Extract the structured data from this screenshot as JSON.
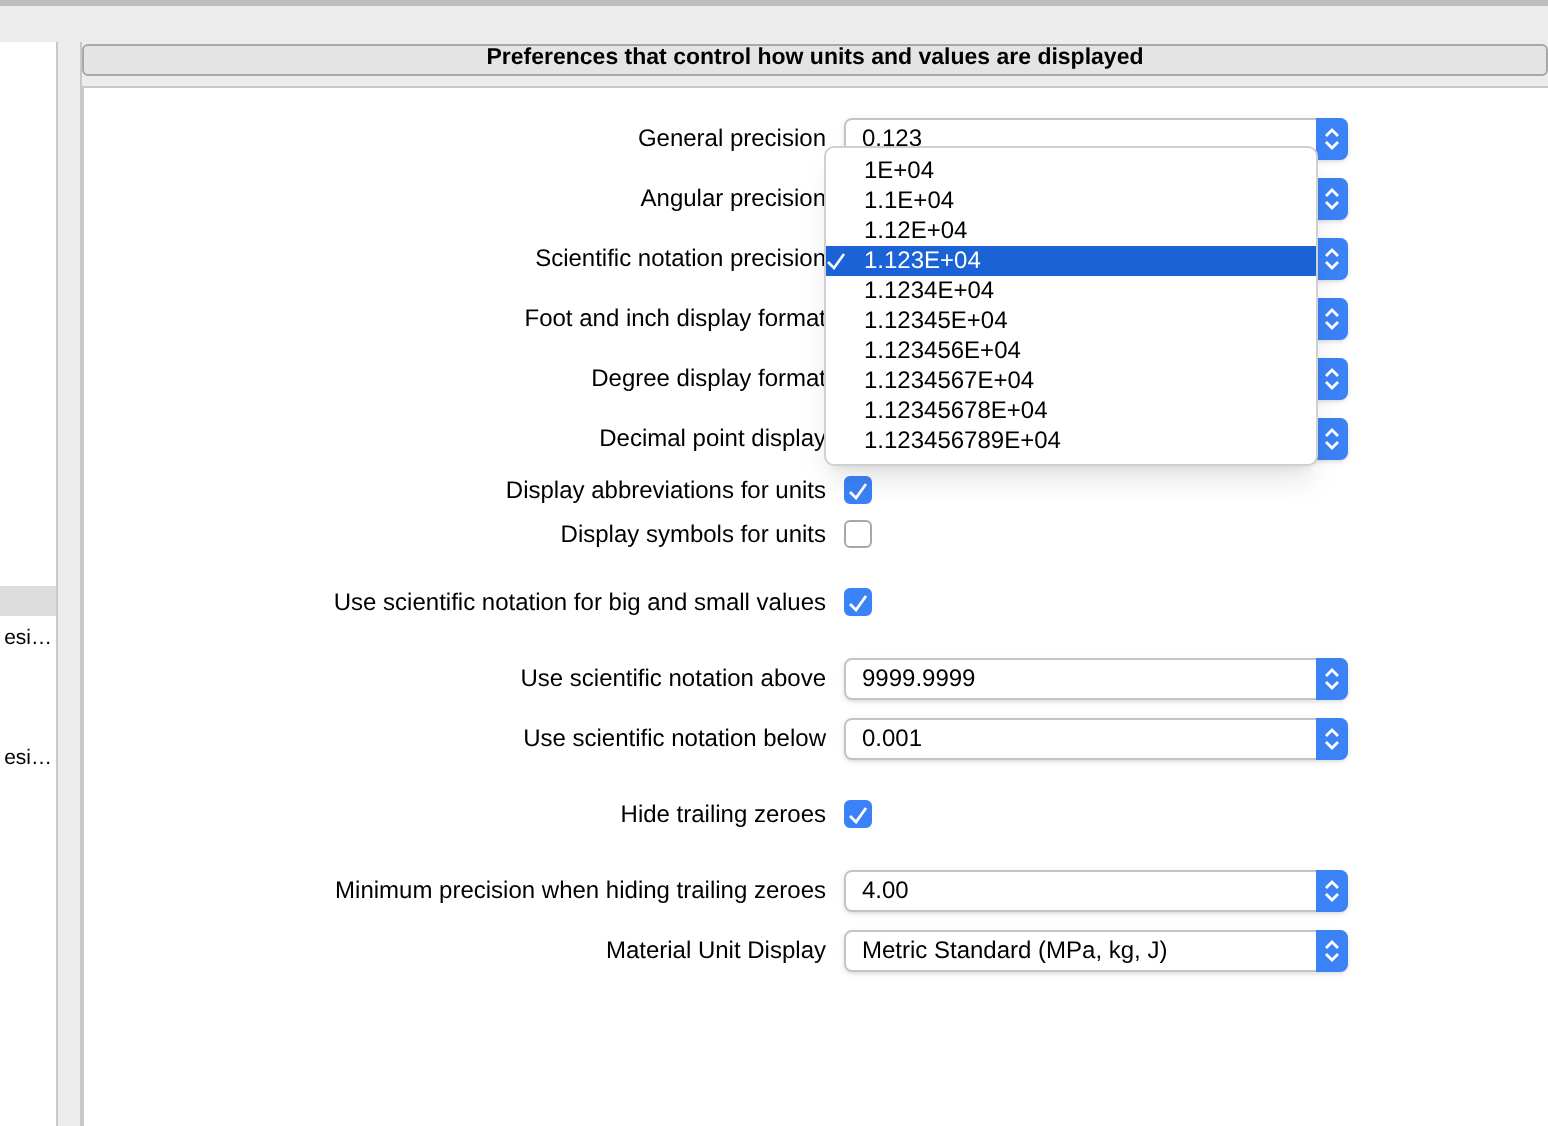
{
  "sidebar": {
    "items": [
      {
        "selected": true
      },
      {
        "label": "esi…",
        "selected": false
      },
      {
        "label": "esi…",
        "selected": false
      }
    ]
  },
  "header": {
    "title": "Preferences that control how units and values are displayed"
  },
  "groups": [
    [
      {
        "kind": "popup",
        "label": "General precision",
        "value": "0.123"
      },
      {
        "kind": "popup",
        "label": "Angular precision"
      },
      {
        "kind": "popup",
        "label": "Scientific notation precision",
        "menu": [
          {
            "label": "1E+04",
            "selected": false
          },
          {
            "label": "1.1E+04",
            "selected": false
          },
          {
            "label": "1.12E+04",
            "selected": false
          },
          {
            "label": "1.123E+04",
            "selected": true
          },
          {
            "label": "1.1234E+04",
            "selected": false
          },
          {
            "label": "1.12345E+04",
            "selected": false
          },
          {
            "label": "1.123456E+04",
            "selected": false
          },
          {
            "label": "1.1234567E+04",
            "selected": false
          },
          {
            "label": "1.12345678E+04",
            "selected": false
          },
          {
            "label": "1.123456789E+04",
            "selected": false
          }
        ]
      },
      {
        "kind": "popup",
        "label": "Foot and inch display format"
      },
      {
        "kind": "popup",
        "label": "Degree display format"
      },
      {
        "kind": "popup",
        "label": "Decimal point display"
      },
      {
        "kind": "checkbox",
        "label": "Display abbreviations for units",
        "checked": true
      },
      {
        "kind": "checkbox",
        "label": "Display symbols for units",
        "checked": false
      }
    ],
    [
      {
        "kind": "checkbox",
        "label": "Use scientific notation for big and small values",
        "checked": true
      }
    ],
    [
      {
        "kind": "popup",
        "label": "Use scientific notation above",
        "value": "9999.9999"
      },
      {
        "kind": "popup",
        "label": "Use scientific notation below",
        "value": "0.001"
      }
    ],
    [
      {
        "kind": "checkbox",
        "label": "Hide trailing zeroes",
        "checked": true
      }
    ],
    [
      {
        "kind": "popup",
        "label": "Minimum precision when hiding trailing zeroes",
        "value": "4.00"
      },
      {
        "kind": "popup",
        "label": "Material Unit Display",
        "value": "Metric Standard (MPa, kg, J)"
      }
    ]
  ]
}
